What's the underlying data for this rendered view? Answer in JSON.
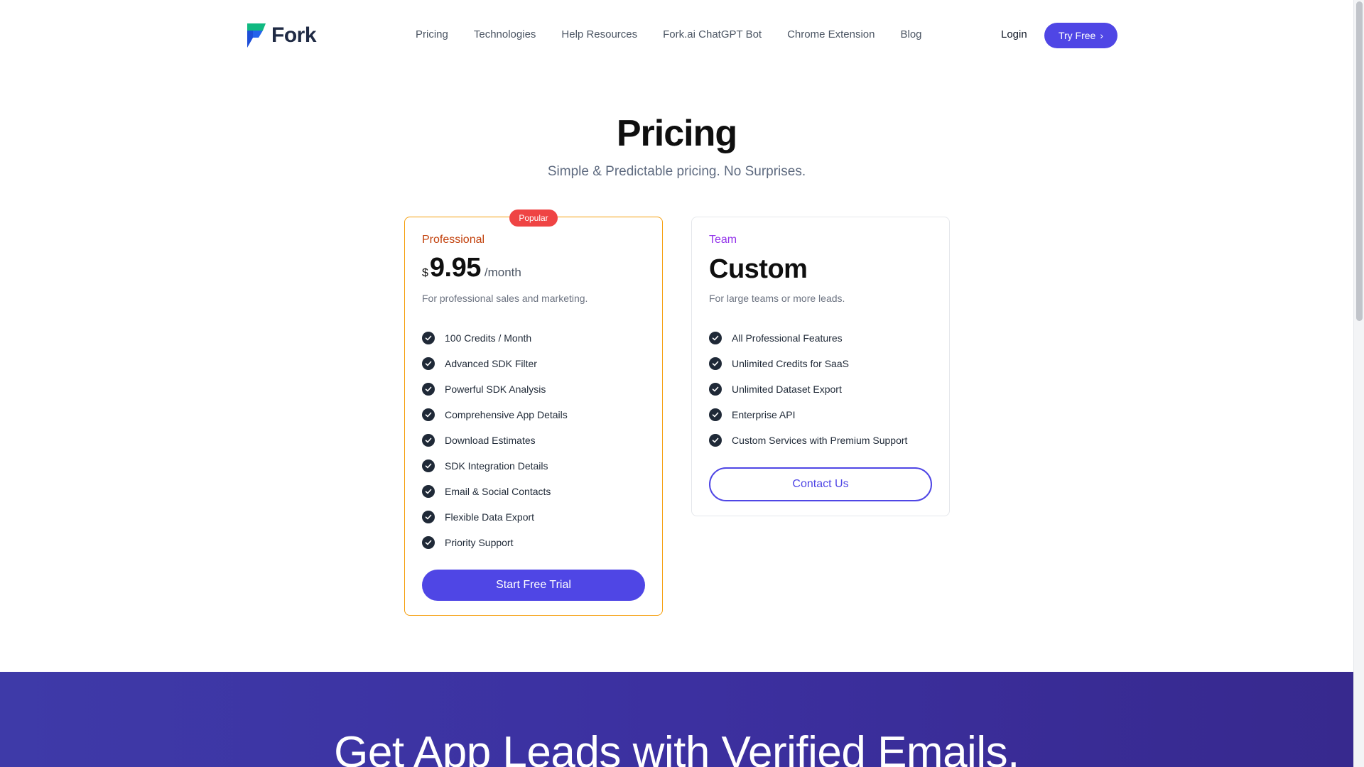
{
  "brand": {
    "name": "Fork",
    "logo_icon": "fork-logo-icon",
    "colors": {
      "primary": "#4f46e5",
      "logo_green": "#10b981",
      "logo_blue": "#2563eb"
    }
  },
  "nav": {
    "items": [
      {
        "label": "Pricing"
      },
      {
        "label": "Technologies"
      },
      {
        "label": "Help Resources"
      },
      {
        "label": "Fork.ai ChatGPT Bot"
      },
      {
        "label": "Chrome Extension"
      },
      {
        "label": "Blog"
      }
    ],
    "login": "Login",
    "try_free": "Try Free",
    "try_free_icon": "chevron-right-icon"
  },
  "hero": {
    "title": "Pricing",
    "subtitle": "Simple & Predictable pricing. No Surprises."
  },
  "plans": {
    "professional": {
      "badge": "Popular",
      "tier": "Professional",
      "currency": "$",
      "amount": "9.95",
      "period": "/month",
      "description": "For professional sales and marketing.",
      "features": [
        "100 Credits / Month",
        "Advanced SDK Filter",
        "Powerful SDK Analysis",
        "Comprehensive App Details",
        "Download Estimates",
        "SDK Integration Details",
        "Email & Social Contacts",
        "Flexible Data Export",
        "Priority Support"
      ],
      "cta": "Start Free Trial",
      "accent": "#f59e0b"
    },
    "team": {
      "tier": "Team",
      "price": "Custom",
      "description": "For large teams or more leads.",
      "features": [
        "All Professional Features",
        "Unlimited Credits for SaaS",
        "Unlimited Dataset Export",
        "Enterprise API",
        "Custom Services with Premium Support"
      ],
      "cta": "Contact Us"
    }
  },
  "banner": {
    "title": "Get App Leads with Verified Emails."
  }
}
